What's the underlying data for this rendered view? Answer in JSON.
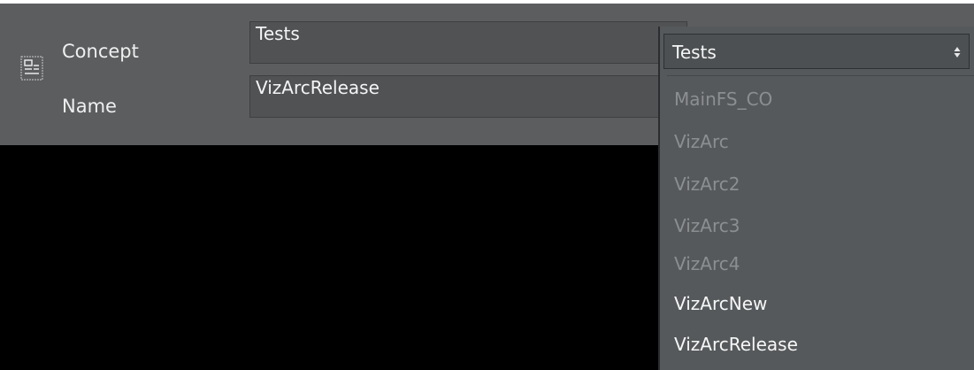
{
  "form": {
    "concept": {
      "label": "Concept",
      "value": "Tests"
    },
    "name": {
      "label": "Name",
      "value": "VizArcRelease"
    }
  },
  "dropdown": {
    "selected": "Tests",
    "options": [
      {
        "label": "MainFS_CO",
        "enabled": false
      },
      {
        "label": "VizArc",
        "enabled": false
      },
      {
        "label": "VizArc2",
        "enabled": false
      },
      {
        "label": "VizArc3",
        "enabled": false
      },
      {
        "label": "VizArc4",
        "enabled": false
      },
      {
        "label": "VizArcNew",
        "enabled": true
      },
      {
        "label": "VizArcRelease",
        "enabled": true
      }
    ]
  },
  "icons": {
    "form": "form-icon",
    "combo_arrow": "updown-arrow-icon"
  },
  "colors": {
    "panel": "#5b5d5f",
    "background": "#000000",
    "disabled_text": "#8c8f91",
    "enabled_text": "#f6f7f7"
  }
}
